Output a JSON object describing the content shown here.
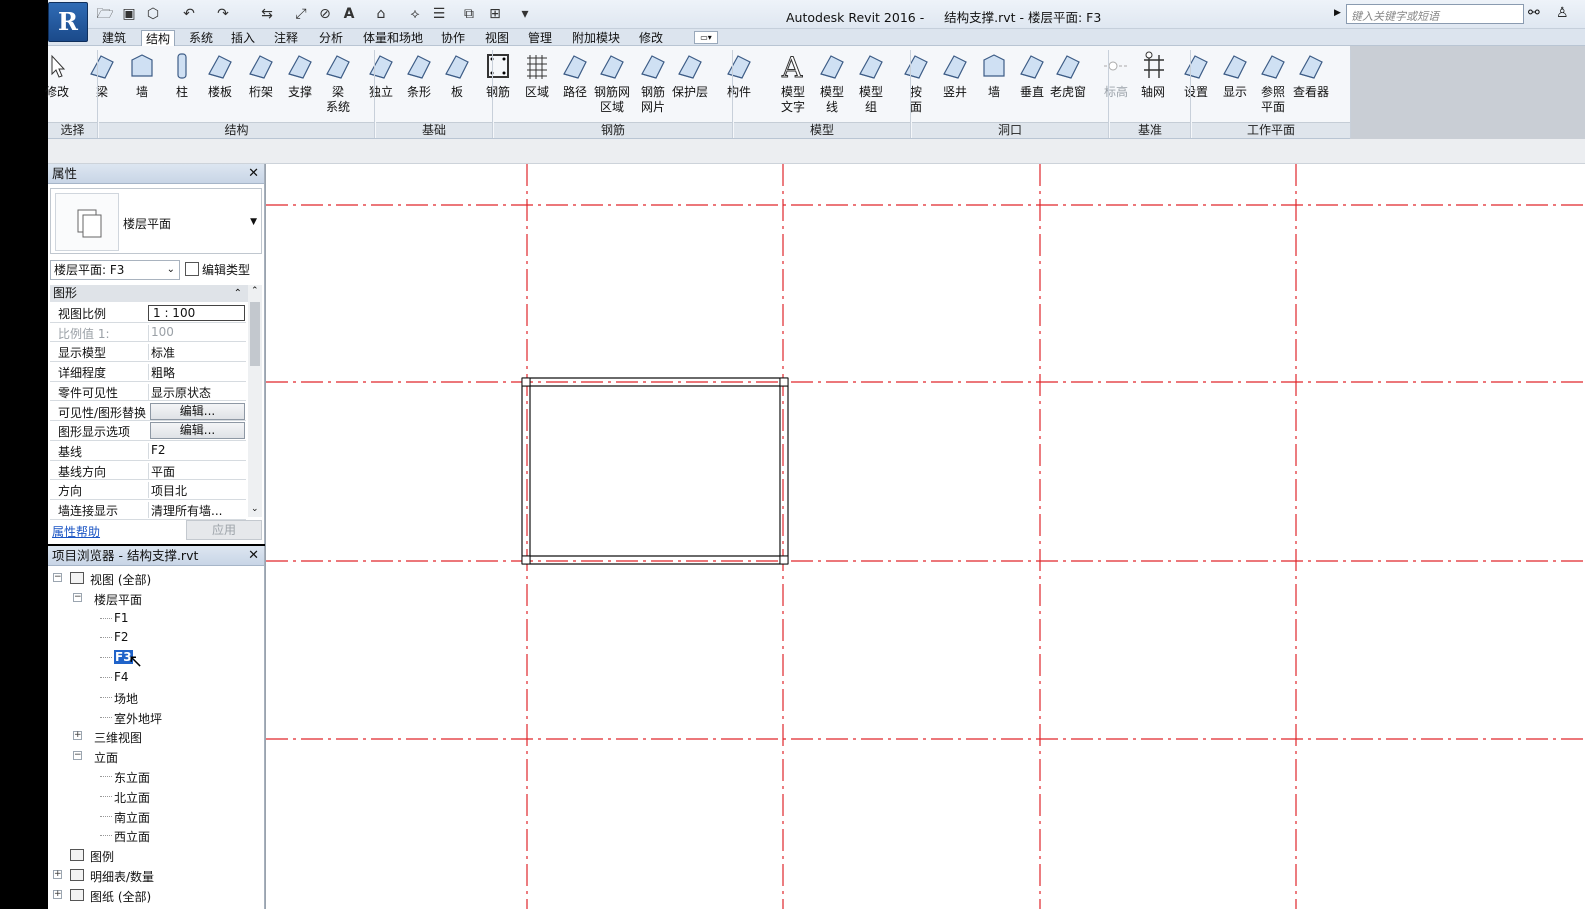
{
  "window": {
    "title": "Autodesk Revit 2016 -     结构支撑.rvt - 楼层平面: F3",
    "search_placeholder": "键入关键字或短语",
    "app_letter": "R"
  },
  "tabs": [
    "建筑",
    "结构",
    "系统",
    "插入",
    "注释",
    "分析",
    "体量和场地",
    "协作",
    "视图",
    "管理",
    "附加模块",
    "修改"
  ],
  "active_tab": "结构",
  "ribbon": {
    "buttons": [
      {
        "label": "修改",
        "icon": "cursor-icon"
      },
      {
        "label": "梁",
        "icon": "beam-icon"
      },
      {
        "label": "墙",
        "icon": "wall-icon"
      },
      {
        "label": "柱",
        "icon": "column-icon"
      },
      {
        "label": "楼板",
        "icon": "floor-icon"
      },
      {
        "label": "桁架",
        "icon": "truss-icon"
      },
      {
        "label": "支撑",
        "icon": "brace-icon"
      },
      {
        "label": "梁\n系统",
        "icon": "beam-system-icon"
      },
      {
        "label": "独立",
        "icon": "isolated-foundation-icon"
      },
      {
        "label": "条形",
        "icon": "strip-foundation-icon"
      },
      {
        "label": "板",
        "icon": "slab-icon"
      },
      {
        "label": "钢筋",
        "icon": "rebar-icon"
      },
      {
        "label": "区域",
        "icon": "area-rebar-icon"
      },
      {
        "label": "路径",
        "icon": "path-rebar-icon"
      },
      {
        "label": "钢筋网\n区域",
        "icon": "fabric-area-icon"
      },
      {
        "label": "钢筋\n网片",
        "icon": "fabric-sheet-icon"
      },
      {
        "label": "保护层",
        "icon": "cover-icon"
      },
      {
        "label": "构件",
        "icon": "component-icon"
      },
      {
        "label": "模型\n文字",
        "icon": "model-text-icon"
      },
      {
        "label": "模型\n线",
        "icon": "model-line-icon"
      },
      {
        "label": "模型\n组",
        "icon": "model-group-icon"
      },
      {
        "label": "按\n面",
        "icon": "by-face-icon"
      },
      {
        "label": "竖井",
        "icon": "shaft-icon"
      },
      {
        "label": "墙",
        "icon": "wall-opening-icon"
      },
      {
        "label": "垂直",
        "icon": "vertical-opening-icon"
      },
      {
        "label": "老虎窗",
        "icon": "dormer-icon"
      },
      {
        "label": "标高",
        "icon": "level-icon"
      },
      {
        "label": "轴网",
        "icon": "grid-icon"
      },
      {
        "label": "设置",
        "icon": "set-workplane-icon"
      },
      {
        "label": "显示",
        "icon": "show-workplane-icon"
      },
      {
        "label": "参照\n平面",
        "icon": "ref-plane-icon"
      },
      {
        "label": "查看器",
        "icon": "viewer-icon"
      }
    ],
    "panels": [
      "选择",
      "结构",
      "基础",
      "钢筋",
      "模型",
      "洞口",
      "基准",
      "工作平面"
    ]
  },
  "properties": {
    "title": "属性",
    "type_name": "楼层平面",
    "instance_selector": "楼层平面: F3",
    "edit_type": "编辑类型",
    "group": "图形",
    "rows": [
      {
        "key": "视图比例",
        "value": "1 : 100"
      },
      {
        "key": "比例值 1:",
        "value": "100"
      },
      {
        "key": "显示模型",
        "value": "标准"
      },
      {
        "key": "详细程度",
        "value": "粗略"
      },
      {
        "key": "零件可见性",
        "value": "显示原状态"
      },
      {
        "key": "可见性/图形替换",
        "value": "编辑..."
      },
      {
        "key": "图形显示选项",
        "value": "编辑..."
      },
      {
        "key": "基线",
        "value": "F2"
      },
      {
        "key": "基线方向",
        "value": "平面"
      },
      {
        "key": "方向",
        "value": "项目北"
      },
      {
        "key": "墙连接显示",
        "value": "清理所有墙..."
      }
    ],
    "help_link": "属性帮助",
    "apply": "应用"
  },
  "browser": {
    "title": "项目浏览器 - 结构支撑.rvt",
    "nodes": [
      {
        "label": "视图 (全部)",
        "level": 0,
        "box": "−"
      },
      {
        "label": "楼层平面",
        "level": 1,
        "box": "−"
      },
      {
        "label": "F1",
        "level": 2
      },
      {
        "label": "F2",
        "level": 2
      },
      {
        "label": "F3",
        "level": 2,
        "selected": true
      },
      {
        "label": "F4",
        "level": 2
      },
      {
        "label": "场地",
        "level": 2
      },
      {
        "label": "室外地坪",
        "level": 2
      },
      {
        "label": "三维视图",
        "level": 1,
        "box": "+"
      },
      {
        "label": "立面",
        "level": 1,
        "box": "−"
      },
      {
        "label": "东立面",
        "level": 2
      },
      {
        "label": "北立面",
        "level": 2
      },
      {
        "label": "南立面",
        "level": 2
      },
      {
        "label": "西立面",
        "level": 2
      },
      {
        "label": "图例",
        "level": 0
      },
      {
        "label": "明细表/数量",
        "level": 0,
        "box": "+"
      },
      {
        "label": "图纸 (全部)",
        "level": 0,
        "box": "+"
      }
    ]
  },
  "colors": {
    "grid_line": "#e0262b",
    "selection": "#2063c9"
  }
}
